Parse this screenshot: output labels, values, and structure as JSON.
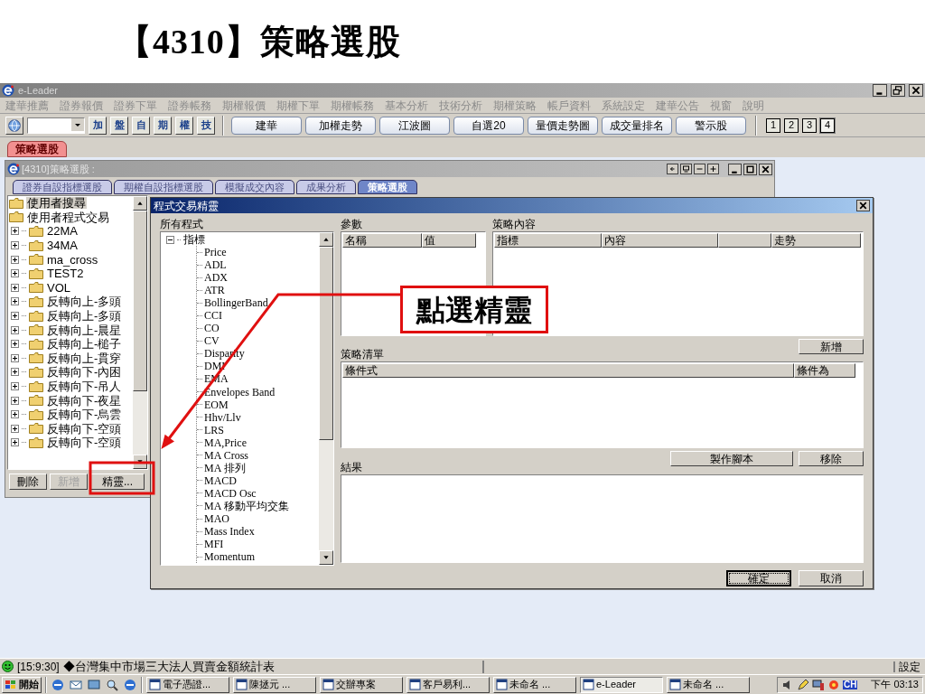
{
  "slide_title": "【4310】策略選股",
  "window": {
    "title": "e-Leader"
  },
  "menu": [
    "建華推薦",
    "證券報價",
    "證券下單",
    "證券帳務",
    "期權報價",
    "期權下單",
    "期權帳務",
    "基本分析",
    "技術分析",
    "期權策略",
    "帳戶資料",
    "系統設定",
    "建華公告",
    "視窗",
    "說明"
  ],
  "toolbar": {
    "quick_buttons": [
      "加",
      "盤",
      "自",
      "期",
      "權",
      "技"
    ],
    "preset_buttons": [
      "建華",
      "加權走勢",
      "江波圖",
      "自選20",
      "量價走勢圖",
      "成交量排名",
      "警示股"
    ],
    "page_buttons": [
      {
        "label": "1",
        "selected": false
      },
      {
        "label": "2",
        "selected": false
      },
      {
        "label": "3",
        "selected": false
      },
      {
        "label": "4",
        "selected": true
      }
    ]
  },
  "doc_tabs": [
    {
      "label": "策略選股",
      "selected": true
    }
  ],
  "inner_window": {
    "title": "[4310]策略選股 :",
    "tabs": [
      {
        "label": "證券自設指標選股",
        "selected": false
      },
      {
        "label": "期權自設指標選股",
        "selected": false
      },
      {
        "label": "模擬成交內容",
        "selected": false
      },
      {
        "label": "成果分析",
        "selected": false
      },
      {
        "label": "策略選股",
        "selected": true
      }
    ],
    "tree": [
      {
        "label": "使用者搜尋",
        "selected": true
      },
      {
        "label": "使用者程式交易",
        "selected": false,
        "children": [
          {
            "label": "22MA",
            "selected": false,
            "expanded": false
          },
          {
            "label": "34MA",
            "selected": false,
            "expanded": false
          },
          {
            "label": "ma_cross",
            "selected": false,
            "expanded": false
          },
          {
            "label": "TEST2",
            "selected": false,
            "expanded": false
          },
          {
            "label": "VOL",
            "selected": false,
            "expanded": false
          },
          {
            "label": "反轉向上-多頭",
            "selected": false,
            "expanded": false
          },
          {
            "label": "反轉向上-多頭",
            "selected": false,
            "expanded": false
          },
          {
            "label": "反轉向上-晨星",
            "selected": false,
            "expanded": false
          },
          {
            "label": "反轉向上-槌子",
            "selected": false,
            "expanded": false
          },
          {
            "label": "反轉向上-貫穿",
            "selected": false,
            "expanded": false
          },
          {
            "label": "反轉向下-內困",
            "selected": false,
            "expanded": false
          },
          {
            "label": "反轉向下-吊人",
            "selected": false,
            "expanded": false
          },
          {
            "label": "反轉向下-夜星",
            "selected": false,
            "expanded": false
          },
          {
            "label": "反轉向下-烏雲",
            "selected": false,
            "expanded": false
          },
          {
            "label": "反轉向下-空頭",
            "selected": false,
            "expanded": false
          },
          {
            "label": "反轉向下-空頭",
            "selected": false,
            "expanded": false
          }
        ]
      }
    ],
    "buttons": [
      {
        "label": "刪除",
        "disabled": false
      },
      {
        "label": "新增",
        "disabled": true
      },
      {
        "label": "精靈...",
        "disabled": false
      }
    ]
  },
  "dialog": {
    "title": "程式交易精靈",
    "programs_label": "所有程式",
    "programs": [
      {
        "label": "指標",
        "expanded": true,
        "children": [
          {
            "label": "Price",
            "selected": false
          },
          {
            "label": "ADL",
            "selected": false
          },
          {
            "label": "ADX",
            "selected": false
          },
          {
            "label": "ATR",
            "selected": false
          },
          {
            "label": "BollingerBand",
            "selected": false
          },
          {
            "label": "CCI",
            "selected": false
          },
          {
            "label": "CO",
            "selected": false
          },
          {
            "label": "CV",
            "selected": false
          },
          {
            "label": "Disparity",
            "selected": false
          },
          {
            "label": "DMI",
            "selected": false
          },
          {
            "label": "EMA",
            "selected": false
          },
          {
            "label": "Envelopes Band",
            "selected": false
          },
          {
            "label": "EOM",
            "selected": false
          },
          {
            "label": "Hhv/Llv",
            "selected": false
          },
          {
            "label": "LRS",
            "selected": false
          },
          {
            "label": "MA,Price",
            "selected": false
          },
          {
            "label": "MA Cross",
            "selected": false
          },
          {
            "label": "MA 排列",
            "selected": false
          },
          {
            "label": "MACD",
            "selected": false
          },
          {
            "label": "MACD Osc",
            "selected": false
          },
          {
            "label": "MA 移動平均交集",
            "selected": false
          },
          {
            "label": "MAO",
            "selected": false
          },
          {
            "label": "Mass Index",
            "selected": false
          },
          {
            "label": "MFI",
            "selected": false
          },
          {
            "label": "Momentum",
            "selected": false
          }
        ]
      }
    ],
    "params": {
      "label": "參數",
      "columns": [
        "名稱",
        "值"
      ]
    },
    "strategy_content": {
      "label": "策略內容",
      "columns": [
        "指標",
        "內容",
        "",
        "走勢"
      ]
    },
    "add_button": "新增",
    "strategy_list": {
      "label": "策略清單",
      "columns": [
        "條件式",
        "條件為"
      ]
    },
    "result_label": "結果",
    "result_buttons": [
      "製作腳本",
      "移除"
    ],
    "footer_buttons": [
      {
        "label": "確定",
        "default": true
      },
      {
        "label": "取消",
        "default": false
      }
    ]
  },
  "status_bar": {
    "time": "[15:9:30]",
    "message": "◆台灣集中市場三大法人買賣金額統計表",
    "settings": "設定"
  },
  "taskbar": {
    "start": "開始",
    "tasks": [
      {
        "label": "電子憑證...",
        "selected": false
      },
      {
        "label": "陳拯元 ...",
        "selected": false
      },
      {
        "label": "交辦專案",
        "selected": false
      },
      {
        "label": "客戶易利...",
        "selected": false
      },
      {
        "label": "未命名 ...",
        "selected": false
      },
      {
        "label": "e-Leader",
        "selected": true
      },
      {
        "label": "未命名 ...",
        "selected": false
      }
    ],
    "ime": "CH",
    "clock": "下午 03:13"
  },
  "annotation": {
    "callout": "點選精靈"
  }
}
